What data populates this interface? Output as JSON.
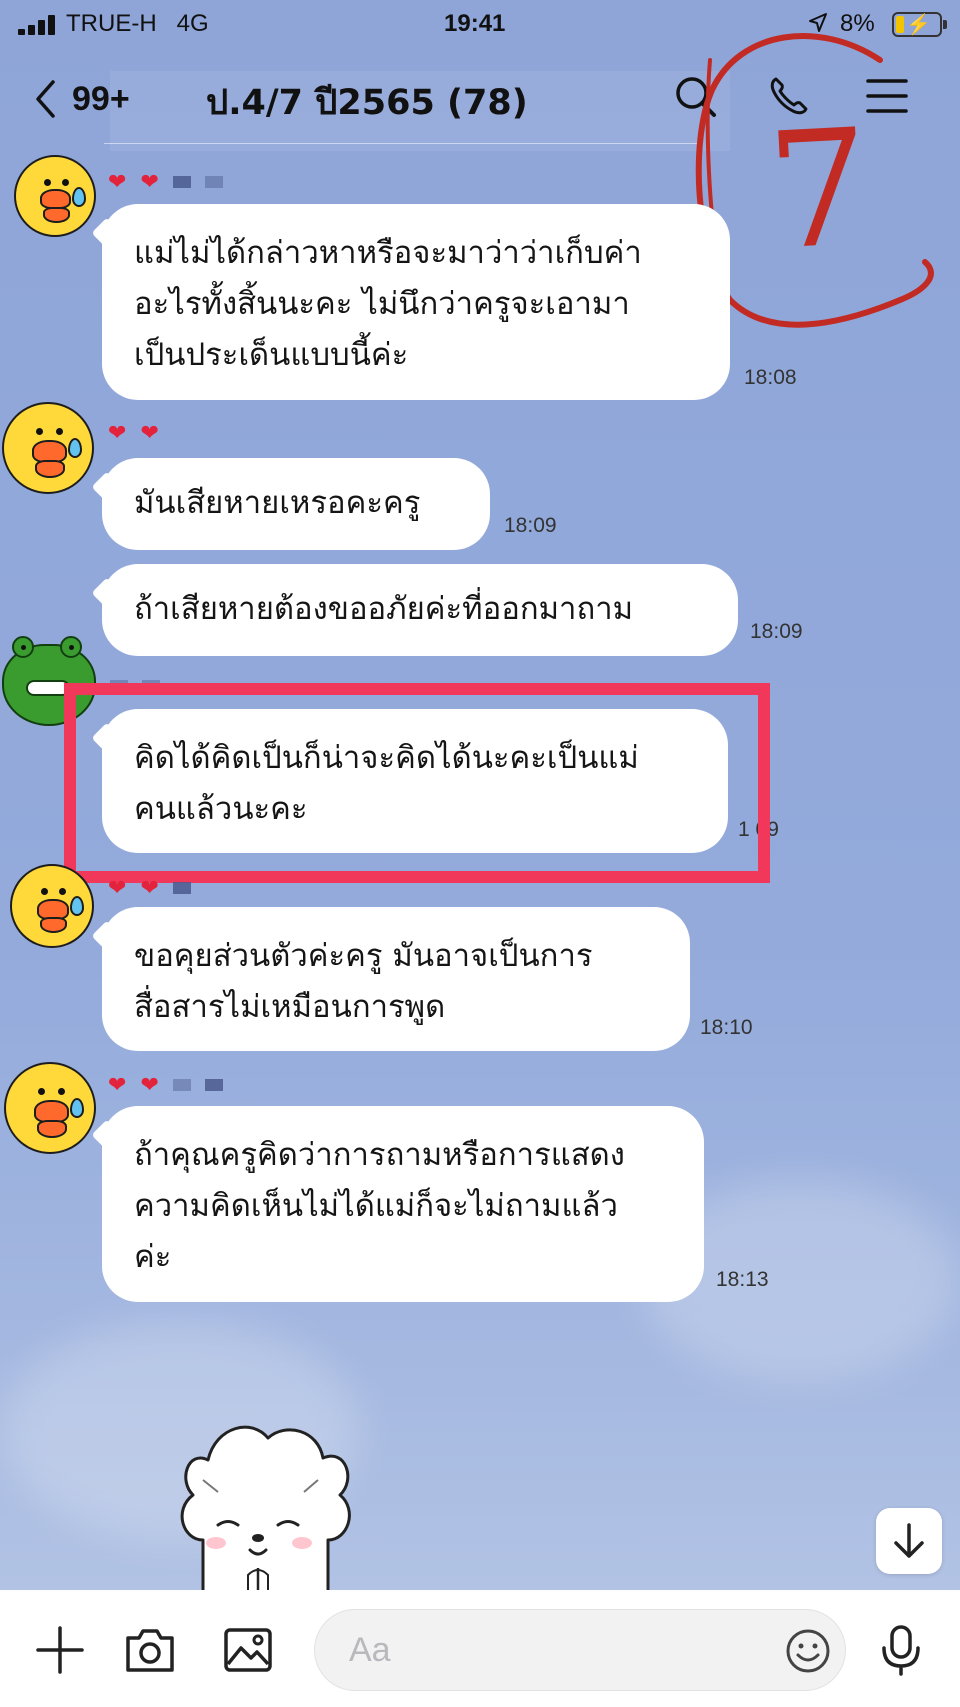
{
  "status_bar": {
    "carrier": "TRUE-H",
    "network": "4G",
    "time": "19:41",
    "battery": "8%"
  },
  "header": {
    "unread_count": "99+",
    "title": "ป.4/7 ปี2565 (78)"
  },
  "annotation": {
    "number": "7",
    "color": "#c22b24"
  },
  "messages": [
    {
      "text": "แม่ไม่ได้กล่าวหาหรือจะมาว่าว่าเก็บค่า\nอะไรทั้งสิ้นนะคะ ไม่นึกว่าครูจะเอามา\nเป็นประเด็นแบบนี้ค่ะ",
      "time": "18:08"
    },
    {
      "text": "มันเสียหายเหรอคะครู",
      "time": "18:09"
    },
    {
      "text": "ถ้าเสียหายต้องขออภัยค่ะที่ออกมาถาม",
      "time": "18:09"
    },
    {
      "text": "คิดได้คิดเป็นก็น่าจะคิดได้นะคะเป็นแม่\nคนแล้วนะคะ",
      "time": "18:09",
      "time_visible": "1  09"
    },
    {
      "text": "ขอคุยส่วนตัวค่ะครู  มันอาจเป็นการ\nสื่อสารไม่เหมือนการพูด",
      "time": "18:10"
    },
    {
      "text": "ถ้าคุณครูคิดว่าการถามหรือการแสดง\nความคิดเห็นไม่ได้แม่ก็จะไม่ถามแล้ว\nค่ะ",
      "time": "18:13"
    }
  ],
  "input": {
    "placeholder": "Aa"
  },
  "colors": {
    "highlight": "#f2385a",
    "background": "#8fa6d6",
    "heart": "#e2233b"
  }
}
